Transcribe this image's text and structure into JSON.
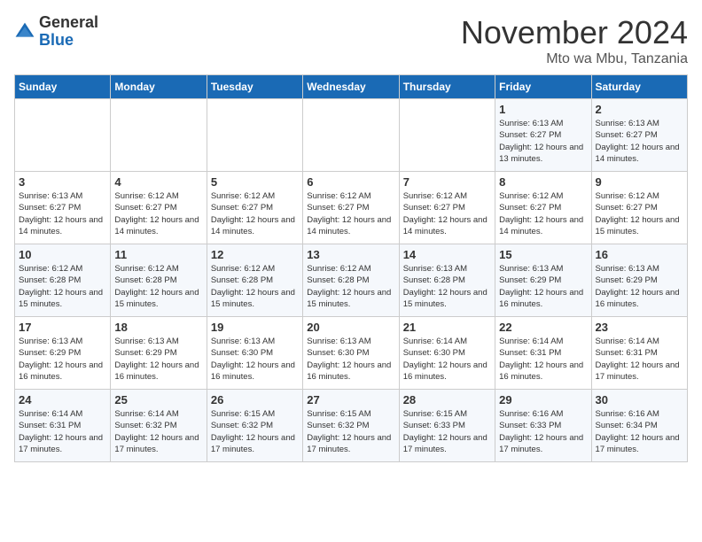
{
  "logo": {
    "general": "General",
    "blue": "Blue"
  },
  "header": {
    "month": "November 2024",
    "location": "Mto wa Mbu, Tanzania"
  },
  "days_of_week": [
    "Sunday",
    "Monday",
    "Tuesday",
    "Wednesday",
    "Thursday",
    "Friday",
    "Saturday"
  ],
  "weeks": [
    [
      {
        "day": "",
        "info": ""
      },
      {
        "day": "",
        "info": ""
      },
      {
        "day": "",
        "info": ""
      },
      {
        "day": "",
        "info": ""
      },
      {
        "day": "",
        "info": ""
      },
      {
        "day": "1",
        "info": "Sunrise: 6:13 AM\nSunset: 6:27 PM\nDaylight: 12 hours\nand 13 minutes."
      },
      {
        "day": "2",
        "info": "Sunrise: 6:13 AM\nSunset: 6:27 PM\nDaylight: 12 hours\nand 14 minutes."
      }
    ],
    [
      {
        "day": "3",
        "info": "Sunrise: 6:13 AM\nSunset: 6:27 PM\nDaylight: 12 hours\nand 14 minutes."
      },
      {
        "day": "4",
        "info": "Sunrise: 6:12 AM\nSunset: 6:27 PM\nDaylight: 12 hours\nand 14 minutes."
      },
      {
        "day": "5",
        "info": "Sunrise: 6:12 AM\nSunset: 6:27 PM\nDaylight: 12 hours\nand 14 minutes."
      },
      {
        "day": "6",
        "info": "Sunrise: 6:12 AM\nSunset: 6:27 PM\nDaylight: 12 hours\nand 14 minutes."
      },
      {
        "day": "7",
        "info": "Sunrise: 6:12 AM\nSunset: 6:27 PM\nDaylight: 12 hours\nand 14 minutes."
      },
      {
        "day": "8",
        "info": "Sunrise: 6:12 AM\nSunset: 6:27 PM\nDaylight: 12 hours\nand 14 minutes."
      },
      {
        "day": "9",
        "info": "Sunrise: 6:12 AM\nSunset: 6:27 PM\nDaylight: 12 hours\nand 15 minutes."
      }
    ],
    [
      {
        "day": "10",
        "info": "Sunrise: 6:12 AM\nSunset: 6:28 PM\nDaylight: 12 hours\nand 15 minutes."
      },
      {
        "day": "11",
        "info": "Sunrise: 6:12 AM\nSunset: 6:28 PM\nDaylight: 12 hours\nand 15 minutes."
      },
      {
        "day": "12",
        "info": "Sunrise: 6:12 AM\nSunset: 6:28 PM\nDaylight: 12 hours\nand 15 minutes."
      },
      {
        "day": "13",
        "info": "Sunrise: 6:12 AM\nSunset: 6:28 PM\nDaylight: 12 hours\nand 15 minutes."
      },
      {
        "day": "14",
        "info": "Sunrise: 6:13 AM\nSunset: 6:28 PM\nDaylight: 12 hours\nand 15 minutes."
      },
      {
        "day": "15",
        "info": "Sunrise: 6:13 AM\nSunset: 6:29 PM\nDaylight: 12 hours\nand 16 minutes."
      },
      {
        "day": "16",
        "info": "Sunrise: 6:13 AM\nSunset: 6:29 PM\nDaylight: 12 hours\nand 16 minutes."
      }
    ],
    [
      {
        "day": "17",
        "info": "Sunrise: 6:13 AM\nSunset: 6:29 PM\nDaylight: 12 hours\nand 16 minutes."
      },
      {
        "day": "18",
        "info": "Sunrise: 6:13 AM\nSunset: 6:29 PM\nDaylight: 12 hours\nand 16 minutes."
      },
      {
        "day": "19",
        "info": "Sunrise: 6:13 AM\nSunset: 6:30 PM\nDaylight: 12 hours\nand 16 minutes."
      },
      {
        "day": "20",
        "info": "Sunrise: 6:13 AM\nSunset: 6:30 PM\nDaylight: 12 hours\nand 16 minutes."
      },
      {
        "day": "21",
        "info": "Sunrise: 6:14 AM\nSunset: 6:30 PM\nDaylight: 12 hours\nand 16 minutes."
      },
      {
        "day": "22",
        "info": "Sunrise: 6:14 AM\nSunset: 6:31 PM\nDaylight: 12 hours\nand 16 minutes."
      },
      {
        "day": "23",
        "info": "Sunrise: 6:14 AM\nSunset: 6:31 PM\nDaylight: 12 hours\nand 17 minutes."
      }
    ],
    [
      {
        "day": "24",
        "info": "Sunrise: 6:14 AM\nSunset: 6:31 PM\nDaylight: 12 hours\nand 17 minutes."
      },
      {
        "day": "25",
        "info": "Sunrise: 6:14 AM\nSunset: 6:32 PM\nDaylight: 12 hours\nand 17 minutes."
      },
      {
        "day": "26",
        "info": "Sunrise: 6:15 AM\nSunset: 6:32 PM\nDaylight: 12 hours\nand 17 minutes."
      },
      {
        "day": "27",
        "info": "Sunrise: 6:15 AM\nSunset: 6:32 PM\nDaylight: 12 hours\nand 17 minutes."
      },
      {
        "day": "28",
        "info": "Sunrise: 6:15 AM\nSunset: 6:33 PM\nDaylight: 12 hours\nand 17 minutes."
      },
      {
        "day": "29",
        "info": "Sunrise: 6:16 AM\nSunset: 6:33 PM\nDaylight: 12 hours\nand 17 minutes."
      },
      {
        "day": "30",
        "info": "Sunrise: 6:16 AM\nSunset: 6:34 PM\nDaylight: 12 hours\nand 17 minutes."
      }
    ]
  ]
}
